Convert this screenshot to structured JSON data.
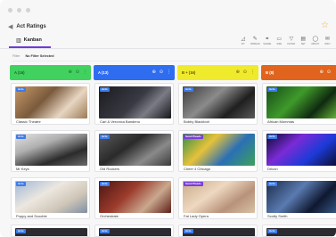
{
  "window": {
    "title": "Act Ratings"
  },
  "view": {
    "label": "Kanban"
  },
  "tools": [
    {
      "label": "FIT",
      "icon": "fit-icon",
      "glyph": "◿"
    },
    {
      "label": "SPREAD",
      "icon": "spread-icon",
      "glyph": "✎"
    },
    {
      "label": "SHARE",
      "icon": "share-icon",
      "glyph": "⚭"
    },
    {
      "label": "SIZE",
      "icon": "size-icon",
      "glyph": "▭"
    },
    {
      "label": "FILTER",
      "icon": "filter-icon",
      "glyph": "▽"
    },
    {
      "label": "SET",
      "icon": "settings-icon",
      "glyph": "▤"
    },
    {
      "label": "ABOUT",
      "icon": "about-icon",
      "glyph": "◯"
    },
    {
      "label": "INFO",
      "icon": "info-icon",
      "glyph": "✉"
    }
  ],
  "filter": {
    "label": "Filter",
    "value": "No Filter Selected"
  },
  "columns": [
    {
      "name": "A (16)",
      "color": "#41d15f",
      "text_color": "#1b5e2b",
      "cards": [
        {
          "name": "Classic Theatre",
          "badge": "Acts",
          "badge_color": "#3f7be8",
          "image": "theatre-photo",
          "bg": "linear-gradient(135deg,#c89a6a 0%,#7a5a3c 40%,#e8d6c2 70%,#9b7a55 100%)"
        },
        {
          "name": "Mr Keys",
          "badge": "Acts",
          "badge_color": "#3f7be8",
          "image": "keyboard-player-photo",
          "bg": "linear-gradient(160deg,#e4e4e4 0%,#b0b0b0 35%,#2b2b2b 70%,#6b6b6b 100%)"
        },
        {
          "name": "Puppy and Scoobie",
          "badge": "Acts",
          "badge_color": "#3f7be8",
          "image": "dogs-photo",
          "bg": "linear-gradient(150deg,#9fb7d8 0%,#ece7df 40%,#cfc6b8 70%,#7f8fa3 100%)"
        }
      ]
    },
    {
      "name": "A (13)",
      "color": "#2f6df0",
      "text_color": "#ffffff",
      "cards": [
        {
          "name": "Carl & Veronica Bandeno",
          "badge": "Acts",
          "badge_color": "#3f7be8",
          "image": "dancers-photo",
          "bg": "linear-gradient(135deg,#1a1a1e 0%,#3a3a44 50%,#7b7b86 70%,#15151a 100%)"
        },
        {
          "name": "Old Rockers",
          "badge": "Acts",
          "badge_color": "#3f7be8",
          "image": "band-photo",
          "bg": "linear-gradient(145deg,#5a5a5a 0%,#2a2a2a 40%,#8a8a8a 70%,#3b3b3b 100%)"
        },
        {
          "name": "Orchestrate",
          "badge": "Acts",
          "badge_color": "#3f7be8",
          "image": "orchestra-photo",
          "bg": "linear-gradient(135deg,#4a1612 0%,#9c3b2c 40%,#c9a88e 70%,#5e1e18 100%)"
        }
      ]
    },
    {
      "name": "B + (16)",
      "color": "#f0ea2c",
      "text_color": "#5a5600",
      "cards": [
        {
          "name": "Bobby Blackbolt",
          "badge": "Acts",
          "badge_color": "#3f7be8",
          "image": "guitarist-photo",
          "bg": "linear-gradient(140deg,#3a3a3a 0%,#8b8b8b 40%,#1f1f1f 70%,#5a5a5a 100%)"
        },
        {
          "name": "Cheer 4 Chicago",
          "badge": "Send Pleads",
          "badge_color": "#7a3fd6",
          "image": "cheerleaders-photo",
          "bg": "linear-gradient(135deg,#2f8f4a 0%,#e6c23a 35%,#2a6fb6 65%,#3da25a 100%)"
        },
        {
          "name": "Fat Lady Opera",
          "badge": "Send Pleads",
          "badge_color": "#7a3fd6",
          "image": "opera-photo",
          "bg": "linear-gradient(145deg,#c8aa8a 0%,#eed8c0 40%,#b8927a 70%,#d8c2a6 100%)"
        }
      ]
    },
    {
      "name": "B (8)",
      "color": "#e0641e",
      "text_color": "#ffffff",
      "cards": [
        {
          "name": "African Mummas",
          "badge": "Acts",
          "badge_color": "#3f7be8",
          "image": "african-dancers-photo",
          "bg": "linear-gradient(135deg,#174a1c 0%,#3f9a2a 40%,#0f2a10 70%,#6dbf3c 100%)"
        },
        {
          "name": "Dricon",
          "badge": "Acts",
          "badge_color": "#3f7be8",
          "image": "laser-show-photo",
          "bg": "linear-gradient(140deg,#0a0a2e 0%,#7a2bd6 35%,#1c3ad8 65%,#0c0c24 100%)"
        },
        {
          "name": "Scotty Smith",
          "badge": "Acts",
          "badge_color": "#3f7be8",
          "image": "drummer-photo",
          "bg": "linear-gradient(135deg,#1b2c4a 0%,#5a7ab0 40%,#0f1830 70%,#3a5a88 100%)"
        }
      ]
    }
  ]
}
